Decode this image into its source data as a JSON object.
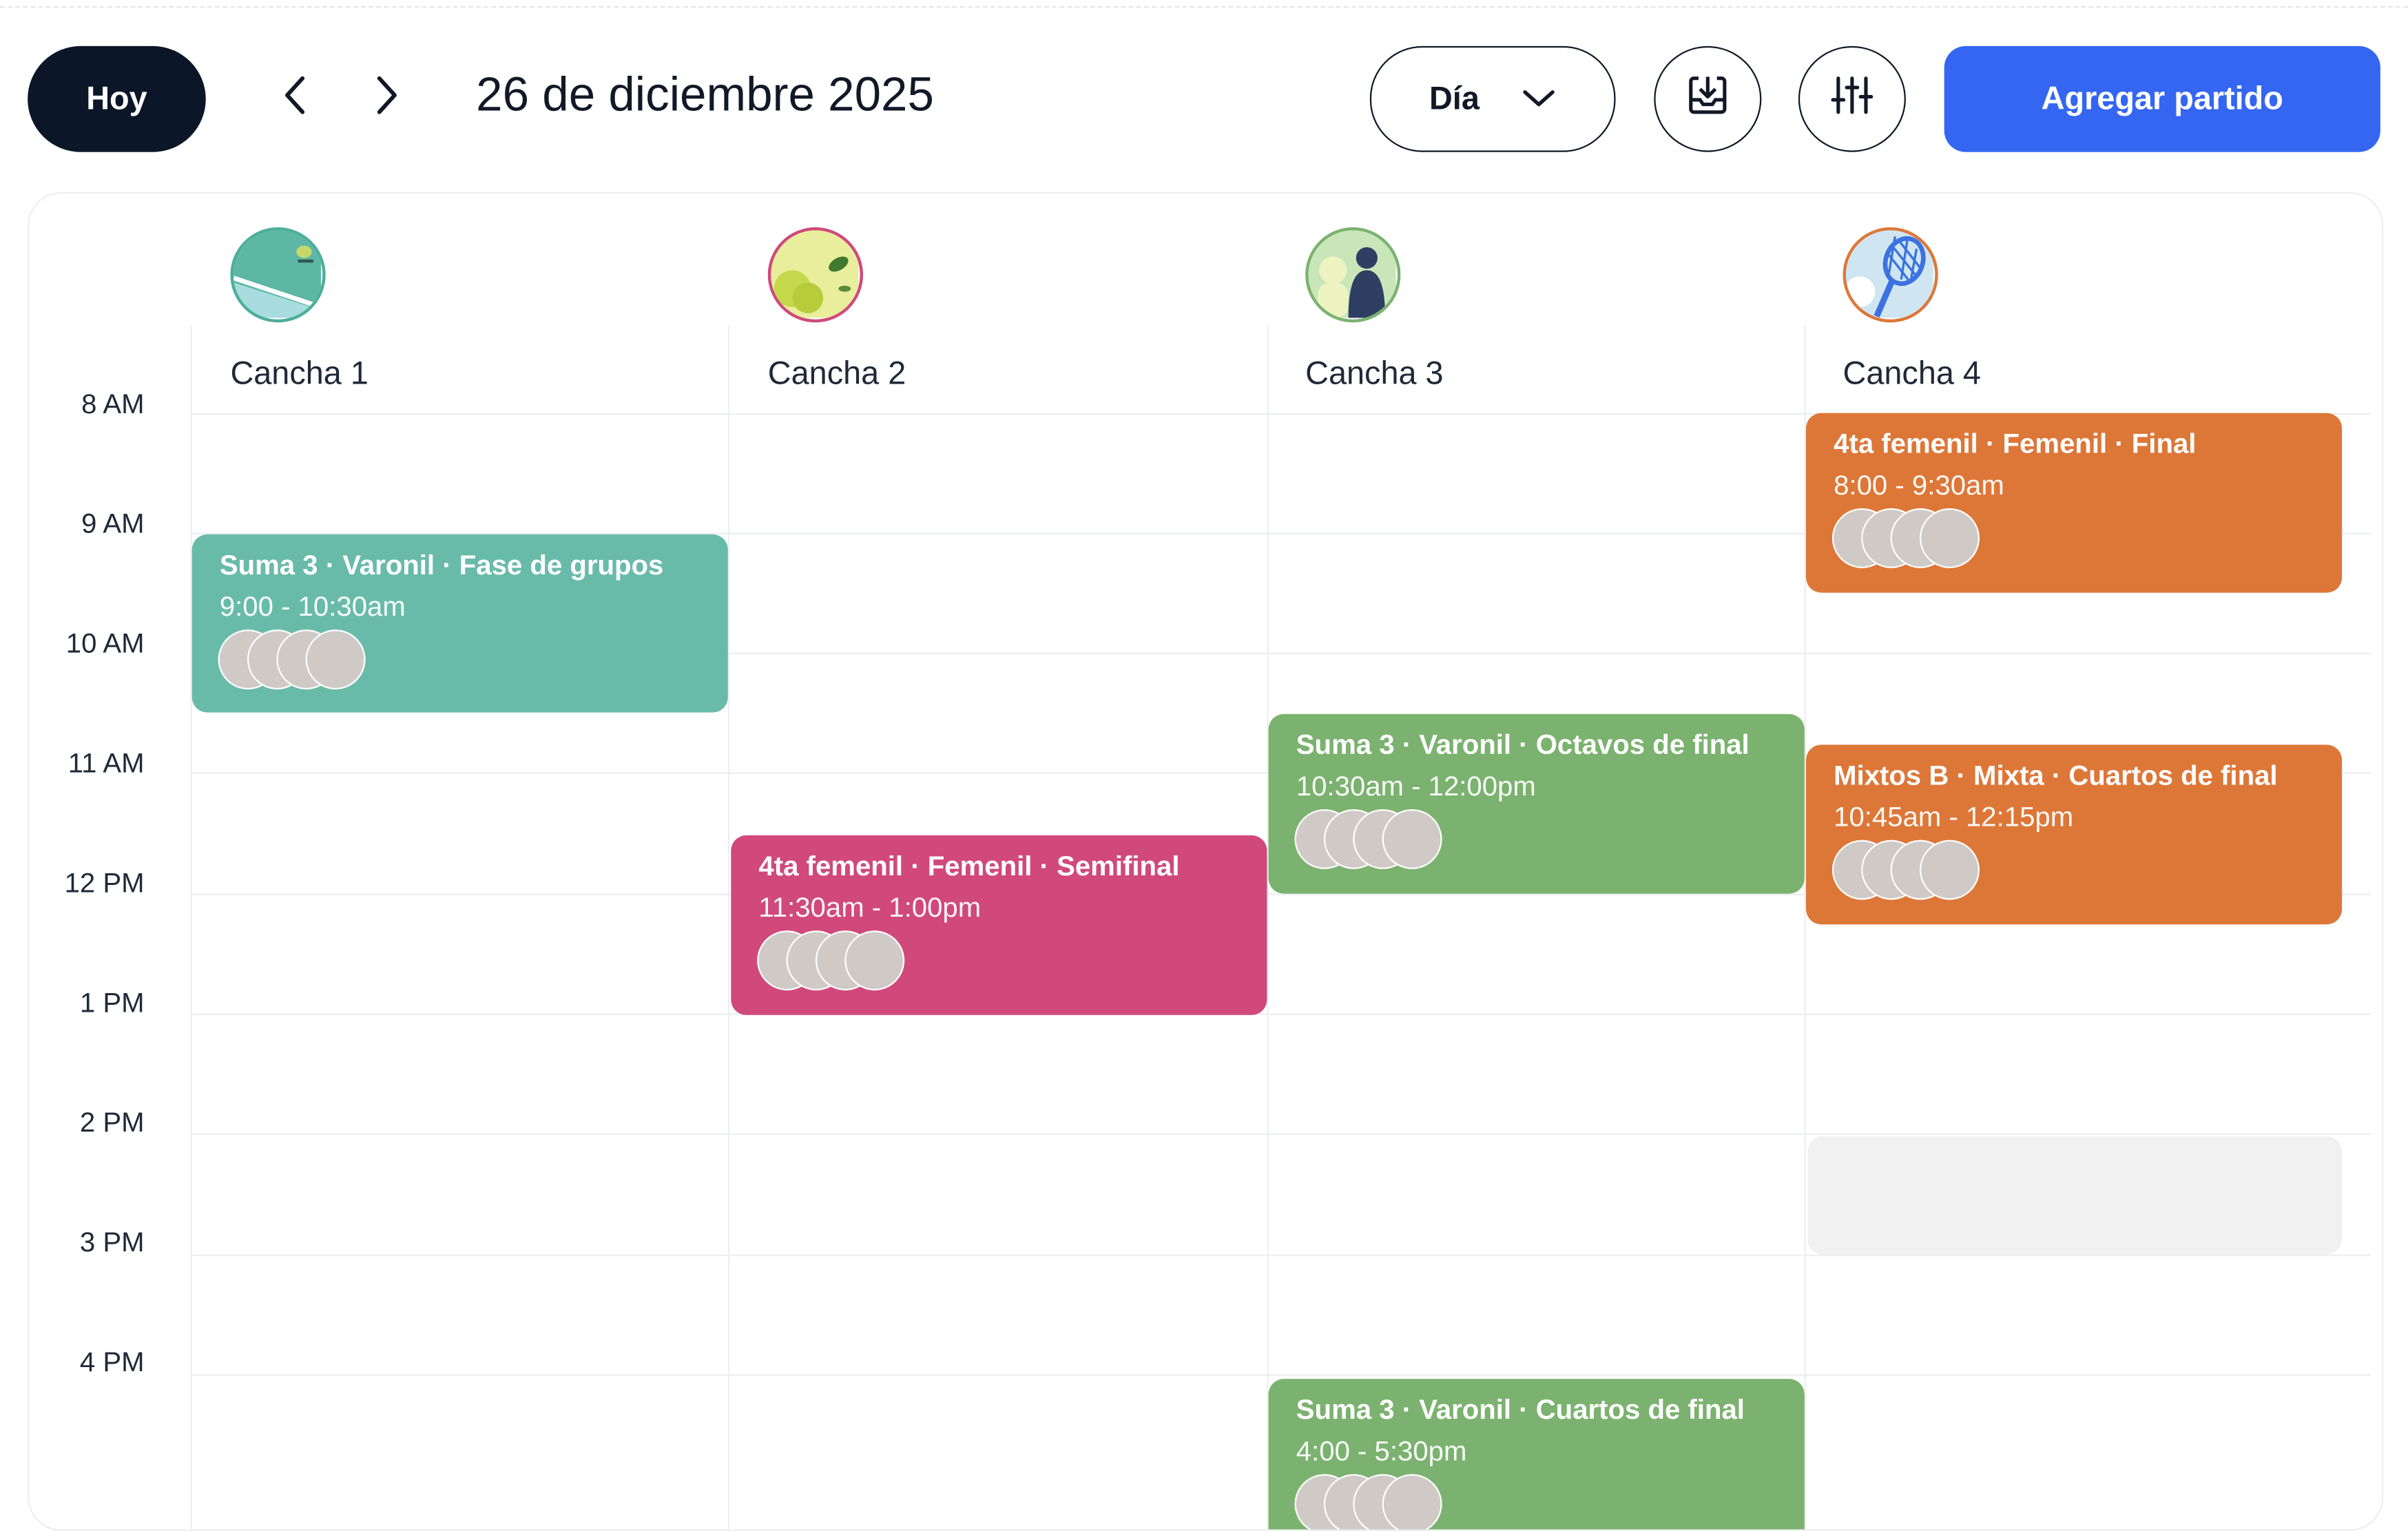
{
  "toolbar": {
    "today_label": "Hoy",
    "date_title": "26 de diciembre 2025",
    "view_label": "Día",
    "add_match_label": "Agregar partido"
  },
  "icons": {
    "prev": "chevron-left-icon",
    "next": "chevron-right-icon",
    "view_dropdown": "chevron-down-icon",
    "download": "download-icon",
    "filters": "sliders-icon"
  },
  "hours": [
    "8 AM",
    "9 AM",
    "10 AM",
    "11 AM",
    "12 PM",
    "1 PM",
    "2 PM",
    "3 PM",
    "4 PM"
  ],
  "courts": [
    {
      "name": "Cancha 1",
      "ring": "#4cae9b"
    },
    {
      "name": "Cancha 2",
      "ring": "#cf4a7b"
    },
    {
      "name": "Cancha 3",
      "ring": "#7bb26f"
    },
    {
      "name": "Cancha 4",
      "ring": "#dd7738"
    }
  ],
  "events": [
    {
      "court": 1,
      "title": "Suma 3 · Varonil · Fase de grupos",
      "time": "9:00 - 10:30am",
      "color": "#69bba9"
    },
    {
      "court": 4,
      "title": "4ta femenil · Femenil · Final",
      "time": "8:00 - 9:30am",
      "color": "#dd7738"
    },
    {
      "court": 3,
      "title": "Suma 3 · Varonil · Octavos de final",
      "time": "10:30am - 12:00pm",
      "color": "#7bb26f"
    },
    {
      "court": 4,
      "title": "Mixtos B · Mixta · Cuartos de final",
      "time": "10:45am - 12:15pm",
      "color": "#dd7738"
    },
    {
      "court": 2,
      "title": "4ta femenil · Femenil · Semifinal",
      "time": "11:30am - 1:00pm",
      "color": "#d0497a"
    },
    {
      "court": 3,
      "title": "Suma 3 · Varonil · Cuartos de final",
      "time": "4:00 - 5:30pm",
      "color": "#7bb26f"
    }
  ]
}
